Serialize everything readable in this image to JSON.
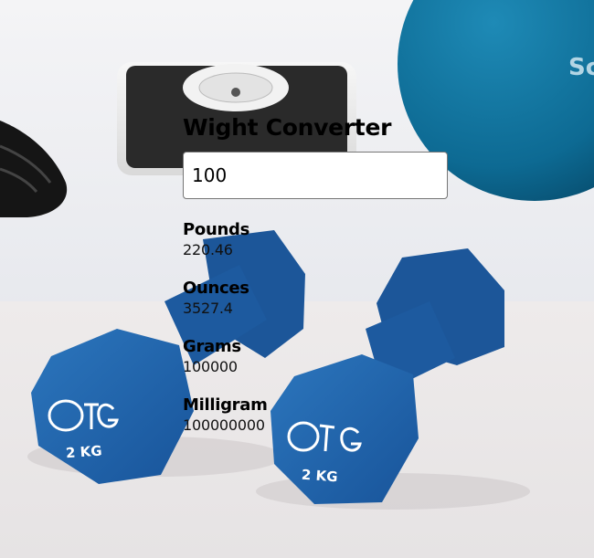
{
  "converter": {
    "title": "Wight Converter",
    "input_value": "100"
  },
  "results": [
    {
      "label": "Pounds",
      "value": "220.46"
    },
    {
      "label": "Ounces",
      "value": "3527.4"
    },
    {
      "label": "Grams",
      "value": "100000"
    },
    {
      "label": "Milligram",
      "value": "100000000"
    }
  ],
  "background": {
    "dumbbell_logo": "OTG",
    "dumbbell_weight": "2 KG",
    "ball_text": "Sc",
    "colors": {
      "dumbbell_blue": "#1f62a6",
      "ball_teal": "#0f6d95",
      "floor": "#ece9e9",
      "wall": "#dfe2e8"
    }
  }
}
